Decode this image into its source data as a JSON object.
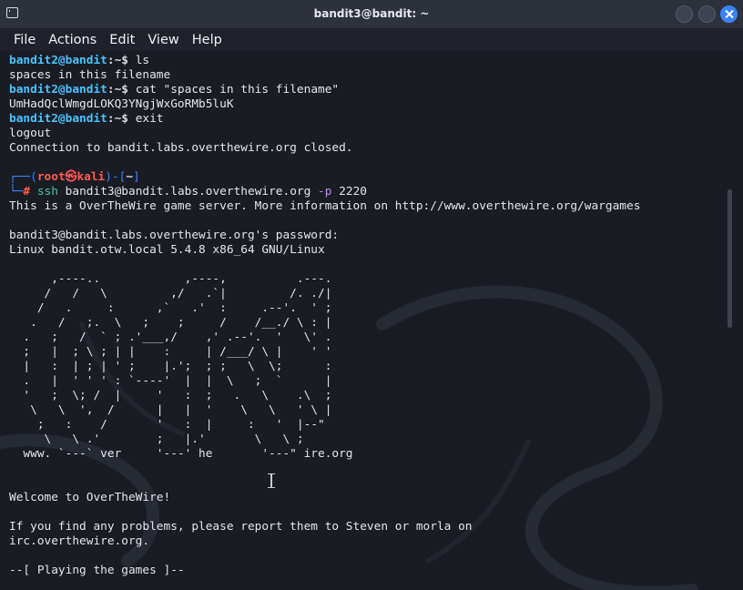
{
  "window": {
    "title": "bandit3@bandit: ~"
  },
  "menu": [
    "File",
    "Actions",
    "Edit",
    "View",
    "Help"
  ],
  "session": {
    "p1_user": "bandit2@bandit",
    "p1_sep": ":~$",
    "cmd1": " ls",
    "out1": "spaces in this filename",
    "p2_user": "bandit2@bandit",
    "p2_sep": ":~$",
    "cmd2": " cat \"spaces in this filename\"",
    "out2": "UmHadQclWmgdLOKQ3YNgjWxGoRMb5luK",
    "p3_user": "bandit2@bandit",
    "p3_sep": ":~$",
    "cmd3": " exit",
    "out3": "logout",
    "out4": "Connection to bandit.labs.overthewire.org closed.",
    "kali_bracket_left": "┌──(",
    "kali_root": "root㉿kali",
    "kali_bracket_mid": ")-[",
    "kali_dir": "~",
    "kali_bracket_right": "]",
    "kali_prompt_start": "└─",
    "kali_hash": "#",
    "ssh_cmd": " ssh",
    "ssh_args": " bandit3@bandit.labs.overthewire.org ",
    "ssh_opt": "-p",
    "ssh_port": " 2220",
    "out5": "This is a OverTheWire game server. More information on http://www.overthewire.org/wargames",
    "out6": "bandit3@bandit.labs.overthewire.org's password:",
    "out7": "Linux bandit.otw.local 5.4.8 x86_64 GNU/Linux",
    "banner": [
      "      ,----..            ,----,          .---.",
      "     /   /   \\         ,/   .`|         /. ./|",
      "    /   .     :      ,`   .'  :     .--'.  ' ;",
      "   .   /   ;.  \\   ;    ;     /    /__./ \\ : |",
      "  .   ;   /  ` ; .'___,/    ,' .--'.  '   \\' .",
      "  ;   |  ; \\ ; | |    :     | /___/ \\ |    ' '",
      "  |   :  | ; | ' ;    |.';  ; ;   \\  \\;      :",
      "  .   |  ' ' ' : `----'  |  |  \\   ;  `      |",
      "  '   ;  \\; /  |     '   :  ;   .   \\    .\\  ;",
      "   \\   \\  ',  /      |   |  '    \\   \\   ' \\ |",
      "    ;   :    /       '   :  |     :   '  |--\"",
      "     \\   \\ .'        ;   |.'       \\   \\ ;",
      "  www. `---` ver     '---' he       '---\" ire.org"
    ],
    "out8": "Welcome to OverTheWire!",
    "out9": "If you find any problems, please report them to Steven or morla on",
    "out10": "irc.overthewire.org.",
    "out11": "--[ Playing the games ]--"
  },
  "colors": {
    "accent": "#3b82f6",
    "prompt_user": "#48c3ff",
    "root_red": "#ff5c57",
    "command_green": "#4fc2a8",
    "option_purple": "#b78af7",
    "background": "#1a1c24"
  },
  "icons": {
    "app": "terminal-icon",
    "minimize": "minimize-icon",
    "maximize": "maximize-icon",
    "close": "close-icon",
    "cursor": "text-cursor-icon"
  }
}
